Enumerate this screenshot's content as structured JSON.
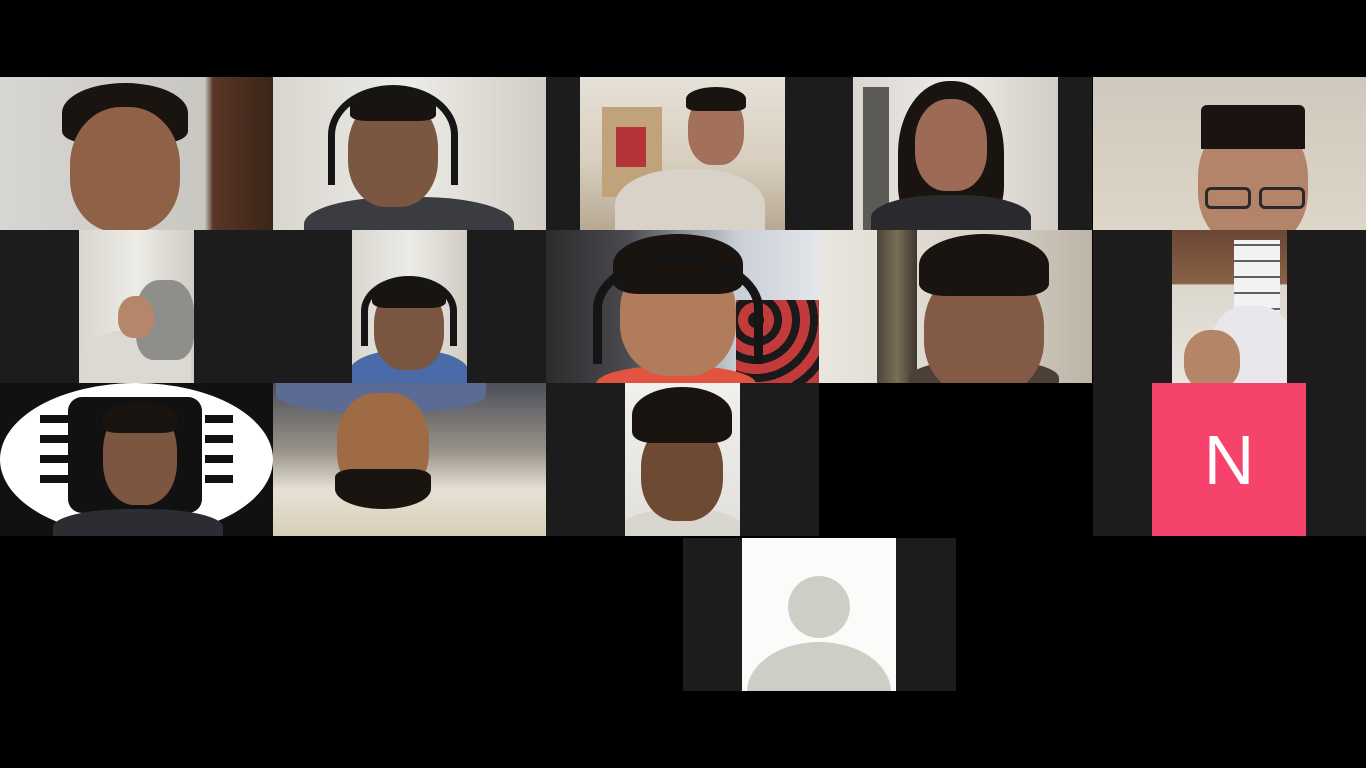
{
  "participants": [
    {
      "id": "p1",
      "kind": "video"
    },
    {
      "id": "p2",
      "kind": "video"
    },
    {
      "id": "p3",
      "kind": "video"
    },
    {
      "id": "p4",
      "kind": "video"
    },
    {
      "id": "p5",
      "kind": "video"
    },
    {
      "id": "p6",
      "kind": "video"
    },
    {
      "id": "p7",
      "kind": "video"
    },
    {
      "id": "p8",
      "kind": "video"
    },
    {
      "id": "p9",
      "kind": "video"
    },
    {
      "id": "p10",
      "kind": "video"
    },
    {
      "id": "p11",
      "kind": "video-with-chip-background"
    },
    {
      "id": "p12",
      "kind": "video-flipped"
    },
    {
      "id": "p13",
      "kind": "video"
    },
    {
      "id": "p14",
      "kind": "camera-off-blank"
    },
    {
      "id": "p15",
      "kind": "avatar-initial"
    },
    {
      "id": "p16",
      "kind": "default-profile-placeholder"
    }
  ],
  "avatar_tile": {
    "initial": "N",
    "color": "#f6436c"
  },
  "placeholder_icon": "user-silhouette-icon",
  "colors": {
    "background": "#000000",
    "tile": "#1c1c1c",
    "placeholder": "#cfcec6"
  }
}
